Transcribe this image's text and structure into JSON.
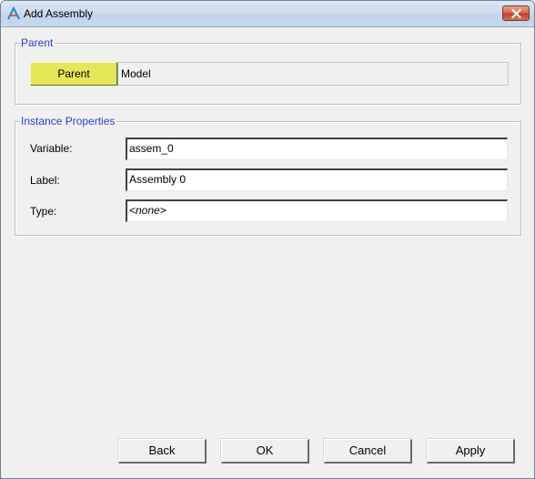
{
  "window": {
    "title": "Add Assembly",
    "icon": "app-a-icon",
    "close_icon": "close-x-icon"
  },
  "parent_group": {
    "legend": "Parent",
    "button_label": "Parent",
    "button_color": "#e6e65a",
    "value": "Model"
  },
  "instance_group": {
    "legend": "Instance Properties",
    "fields": [
      {
        "label": "Variable:",
        "value": "assem_0"
      },
      {
        "label": "Label:",
        "value": "Assembly 0"
      },
      {
        "label": "Type:",
        "value": "<none>"
      }
    ]
  },
  "buttons": {
    "back": "Back",
    "ok": "OK",
    "cancel": "Cancel",
    "apply": "Apply"
  },
  "colors": {
    "legend_text": "#2a3fd0",
    "close_button": "#c9553c"
  }
}
